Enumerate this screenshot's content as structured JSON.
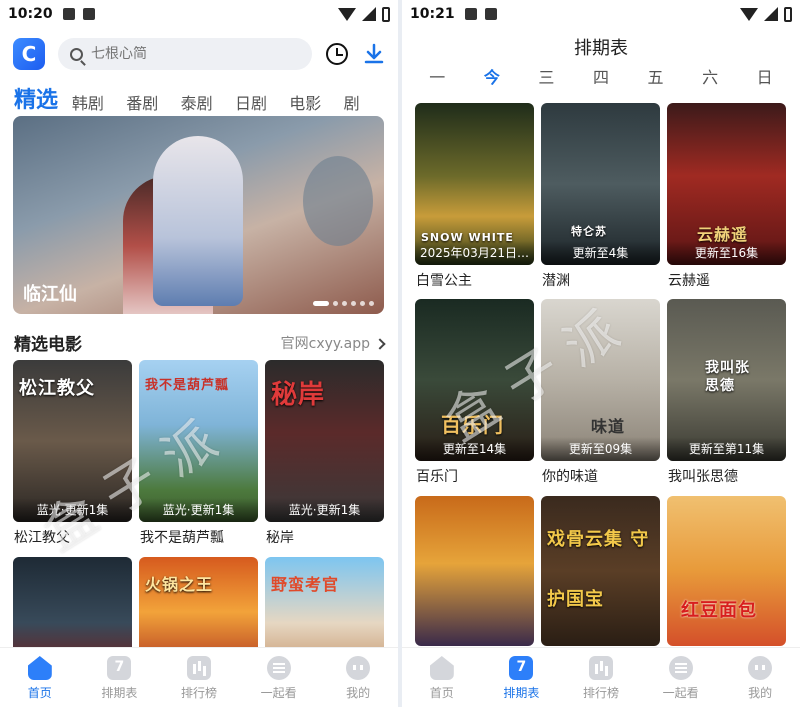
{
  "left": {
    "status": {
      "time": "10:20"
    },
    "search": {
      "placeholder": "七根心简"
    },
    "logo_glyph": "C",
    "tabs": [
      "精选",
      "韩剧",
      "番剧",
      "泰剧",
      "日剧",
      "电影",
      "剧"
    ],
    "banner": {
      "title": "临江仙",
      "pages": 6,
      "current_page": 1
    },
    "section": {
      "title": "精选电影",
      "more": "官网cxyy.app"
    },
    "movies": [
      {
        "title": "松江教父",
        "badge": "蓝光·更新1集",
        "art_text": "松江教父"
      },
      {
        "title": "我不是葫芦瓢",
        "badge": "蓝光·更新1集",
        "art_text": "我不是葫芦瓢"
      },
      {
        "title": "秘岸",
        "badge": "蓝光·更新1集",
        "art_text": "秘岸"
      },
      {
        "title": "",
        "badge": "",
        "art_text": ""
      },
      {
        "title": "",
        "badge": "",
        "art_text": "火锅之王"
      },
      {
        "title": "",
        "badge": "",
        "art_text": "野蛮考官"
      }
    ],
    "watermark": "盒子派"
  },
  "right": {
    "status": {
      "time": "10:21"
    },
    "title": "排期表",
    "days": [
      "一",
      "今",
      "三",
      "四",
      "五",
      "六",
      "日"
    ],
    "shows": [
      {
        "title": "白雪公主",
        "badge": "2025年03月21日…",
        "art_text": "SNOW WHITE"
      },
      {
        "title": "潜渊",
        "badge": "更新至4集",
        "art_text": "特仑苏"
      },
      {
        "title": "云赫遥",
        "badge": "更新至16集",
        "art_text": "云赫遥"
      },
      {
        "title": "百乐门",
        "badge": "更新至14集",
        "art_text": "百乐门"
      },
      {
        "title": "你的味道",
        "badge": "更新至09集",
        "art_text": "味道"
      },
      {
        "title": "我叫张思德",
        "badge": "更新至第11集",
        "art_text": "我叫张思德"
      },
      {
        "title": "",
        "badge": "",
        "art_text": ""
      },
      {
        "title": "",
        "badge": "",
        "art_text": "戏骨云集 守护国宝"
      },
      {
        "title": "",
        "badge": "",
        "art_text": "红豆面包"
      }
    ],
    "watermark": "盒子派"
  },
  "nav": [
    "首页",
    "排期表",
    "排行榜",
    "一起看",
    "我的"
  ],
  "colors": {
    "accent": "#1a73e8",
    "nav_inactive": "#999999"
  }
}
